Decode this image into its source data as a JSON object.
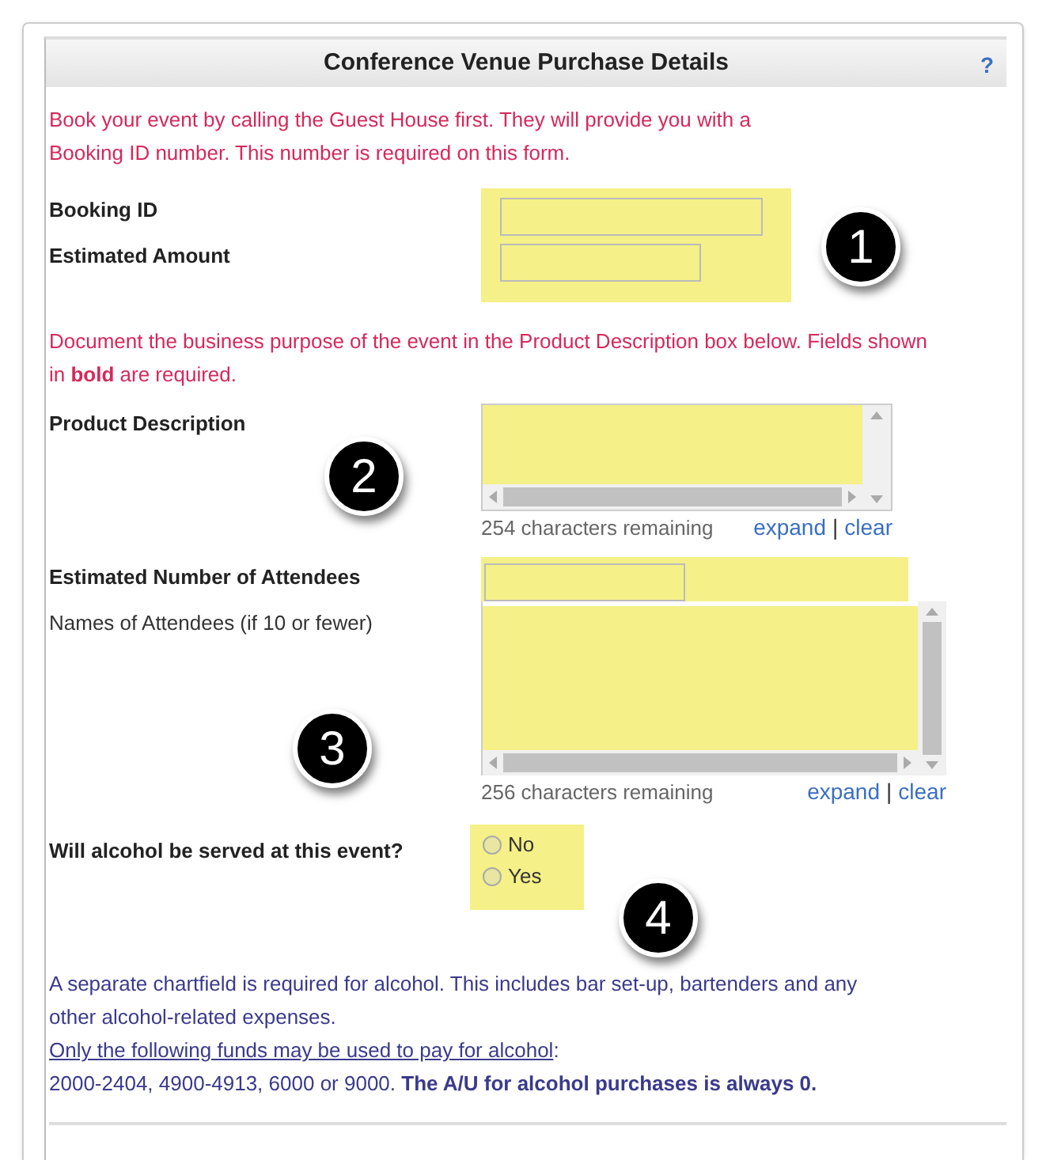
{
  "panel": {
    "title": "Conference Venue Purchase Details",
    "help": "?"
  },
  "intro": "Book your event by calling the Guest House first. They will provide you with a Booking ID number. This number is required on this form.",
  "booking_fields": [
    {
      "label": "Booking ID",
      "required": true
    },
    {
      "label": "Estimated Amount",
      "required": true
    }
  ],
  "purpose_note": "Document the business purpose of the event in the Product Description box below. Fields shown in **bold** are required.",
  "product_description": {
    "label": "Product Description",
    "required": true,
    "remaining": "254 characters remaining",
    "expand": "expand",
    "separator": "|",
    "clear": "clear"
  },
  "attendees_count": {
    "label": "Estimated Number of Attendees",
    "required": true
  },
  "attendee_names": {
    "label": "Names of Attendees (if 10 or fewer)",
    "required": false,
    "remaining": "256 characters remaining",
    "expand": "expand",
    "separator": "|",
    "clear": "clear"
  },
  "alcohol": {
    "label": "Will alcohol be served at this event?",
    "options": [
      {
        "label": "No",
        "selected": false
      },
      {
        "label": "Yes",
        "selected": false
      }
    ]
  },
  "alcohol_notice": {
    "text": "A separate chartfield is required for alcohol. This includes bar set-up, bartenders and any other alcohol-related expenses.",
    "funds_link": "Only the following funds may be used to pay for alcohol",
    "funds_colon": ":",
    "funds": "2000-2404, 4900-4913, 6000 or 9000. **The A/U for alcohol purchases is always 0.**"
  },
  "callouts": [
    "1",
    "2",
    "3",
    "4"
  ]
}
